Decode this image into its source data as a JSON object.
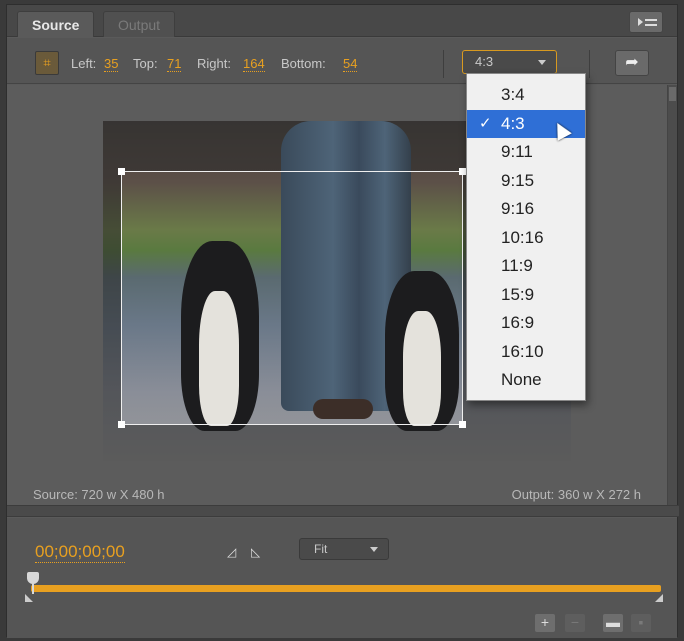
{
  "tabs": [
    {
      "label": "Source",
      "active": true
    },
    {
      "label": "Output",
      "active": false
    }
  ],
  "toolbar": {
    "left_label": "Left:",
    "left_value": "35",
    "top_label": "Top:",
    "top_value": "71",
    "right_label": "Right:",
    "right_value": "164",
    "bottom_label": "Bottom:",
    "bottom_value": "54",
    "aspect_selected": "4:3"
  },
  "aspect_menu": {
    "options": [
      "3:4",
      "4:3",
      "9:11",
      "9:15",
      "9:16",
      "10:16",
      "11:9",
      "15:9",
      "16:9",
      "16:10",
      "None"
    ],
    "selected": "4:3"
  },
  "info": {
    "source": "Source: 720 w X 480 h",
    "output": "Output: 360 w X 272 h"
  },
  "timeline": {
    "timecode": "00;00;00;00",
    "zoom": "Fit",
    "playhead_position": 0
  },
  "colors": {
    "accent": "#e8a020",
    "menu_highlight": "#2f6fd6",
    "panel_bg": "#5a5a5a"
  },
  "icons": {
    "crop": "crop-icon",
    "panel_menu": "panel-menu-icon",
    "share": "share-arrow-icon",
    "mark_in": "mark-in-icon",
    "mark_out": "mark-out-icon",
    "add": "plus-icon",
    "remove": "minus-icon",
    "folder": "folder-icon",
    "trash": "trash-icon"
  }
}
